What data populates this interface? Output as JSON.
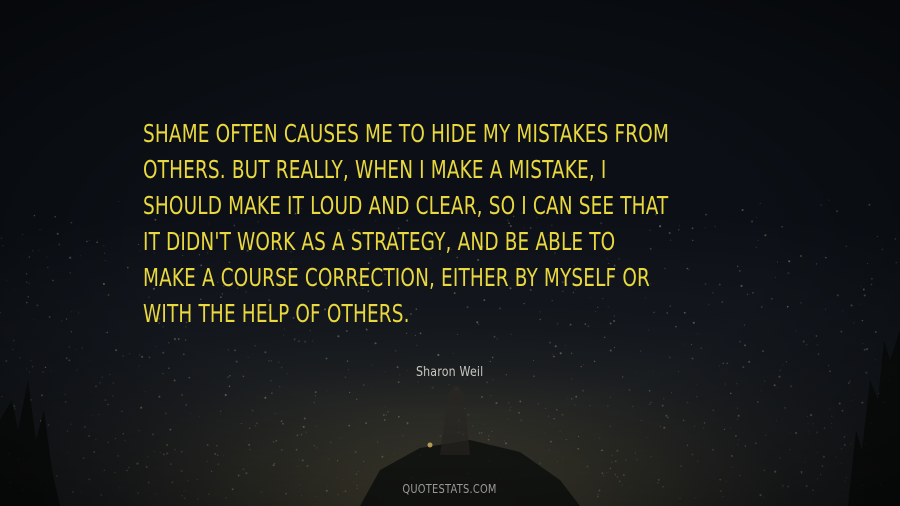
{
  "quote": {
    "lines": [
      "Shame often causes me to hide my mistakes from",
      "others. But really, when I make a mistake, I",
      "should make it loud and clear, so I can see that",
      "it didn't work as a strategy, and be able to",
      "make a course correction, either by myself or",
      "with the help of others."
    ],
    "color": "#e9d83e"
  },
  "author": "Sharon Weil",
  "watermark": "QUOTESTATS.COM"
}
